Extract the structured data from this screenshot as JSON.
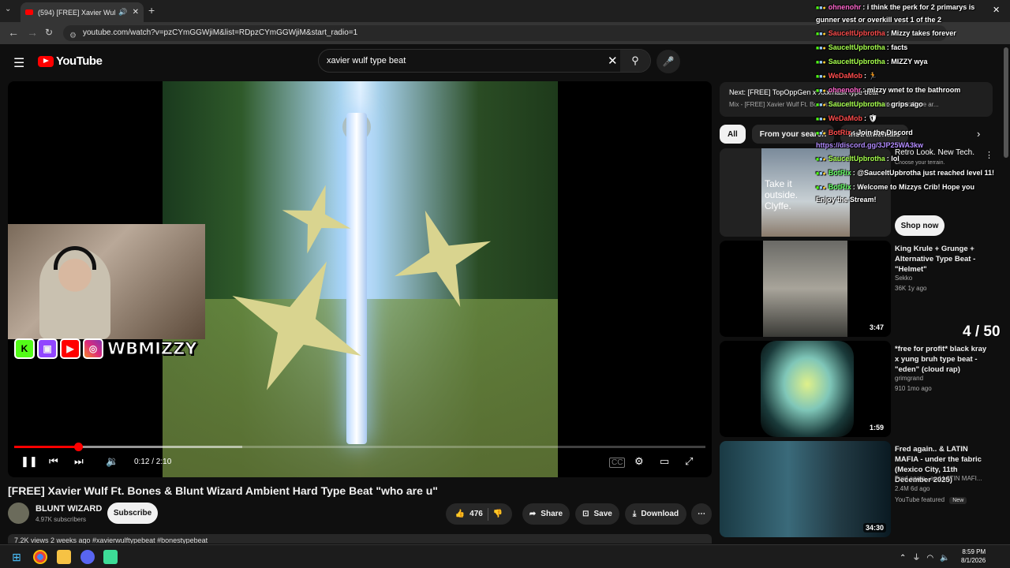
{
  "browser": {
    "tab_title": "(594) [FREE] Xavier Wulf Ft. Bo",
    "url": "youtube.com/watch?v=pzCYmGGWjiM&list=RDpzCYmGGWjiM&start_radio=1"
  },
  "header": {
    "logo_text": "YouTube",
    "search_query": "xavier wulf type beat"
  },
  "player": {
    "current_time": "0:12",
    "duration": "2:10",
    "time_display": "0:12 / 2:10",
    "played_fraction": 0.092,
    "buffered_fraction": 0.33,
    "social_handle": "WBMIZZY"
  },
  "video": {
    "title": "[FREE] Xavier Wulf Ft. Bones & Blunt Wizard Ambient Hard Type Beat \"who are u\"",
    "channel": "BLUNT WIZARD",
    "subscribers": "4.97K subscribers",
    "subscribe_label": "Subscribe",
    "likes": "476",
    "share_label": "Share",
    "save_label": "Save",
    "download_label": "Download",
    "description_peek": "7.2K views  2 weeks ago  #xavierwulftypebeat #bonestypebeat"
  },
  "sidebar": {
    "up_next_line1": "Next: [FREE] TopOppGen x Xxxmask type beat",
    "up_next_line2": "Mix - [FREE] Xavier Wulf Ft. Bones & Blunt Wizard Ambient Hard Type ar...",
    "chips": [
      "All",
      "From your search",
      "Instrumentals"
    ],
    "ad": {
      "image_text": "Take it outside. Clyffe.",
      "title": "Retro Look. New Tech.",
      "subtitle": "Choose your terrain.",
      "cta": "Shop now"
    },
    "recommendations": [
      {
        "title": "King Krule + Grunge + Alternative Type Beat - \"Helmet\"",
        "channel": "Sekko",
        "meta": "36K  1y ago",
        "duration": ""
      },
      {
        "title": "*free for profit* black kray x yung bruh type beat - \"eden\" (cloud rap)",
        "channel": "grimgrand",
        "meta": "910  1mo ago",
        "duration": "1:59"
      },
      {
        "title": "Fred again.. & LATIN MAFIA - under the fabric (Mexico City, 11th December 2025)",
        "channel": "Fred again.. and LATIN MAFI...",
        "meta": "2.4M  6d ago",
        "duration": "34:30",
        "featured": "YouTube featured",
        "badge": "New"
      }
    ],
    "rec1_duration": "3:47"
  },
  "overlay": {
    "counter": "4 / 50",
    "chat": [
      {
        "user": "ohnenohr",
        "color": "#ff66cc",
        "msg": "i think the perk for 2 primarys is gunner vest or overkill vest 1 of the 2"
      },
      {
        "user": "SauceItUpbrotha",
        "color": "#ff4d4d",
        "msg": "Mizzy takes forever"
      },
      {
        "user": "SauceItUpbrotha",
        "color": "#a6ff4d",
        "msg": "facts"
      },
      {
        "user": "SauceItUpbrotha",
        "color": "#a6ff4d",
        "msg": "MIZZY wya"
      },
      {
        "user": "WeDaMob",
        "color": "#ff4d4d",
        "msg": "🏃"
      },
      {
        "user": "ohnenohr",
        "color": "#ff66cc",
        "msg": "mizzy wnet to the bathroom"
      },
      {
        "user": "SauceItUpbrotha",
        "color": "#a6ff4d",
        "msg": "grips ago"
      },
      {
        "user": "WeDaMob",
        "color": "#ff4d4d",
        "msg": "🛡"
      },
      {
        "user": "BotRix",
        "color": "#ff4d4d",
        "msg": "Join the Discord https://discord.gg/3JP25WA3kw"
      },
      {
        "user": "SauceItUpbrotha",
        "color": "#a6ff4d",
        "msg": "lol"
      },
      {
        "user": "BotRix",
        "color": "#66ff66",
        "msg": "@SauceItUpbrotha just reached level 11!"
      },
      {
        "user": "BotRix",
        "color": "#66ff66",
        "msg": "Welcome to Mizzys Crib! Hope you Enjoy the Stream!"
      }
    ]
  },
  "taskbar": {
    "time": "8:59 PM",
    "date": "8/1/2026"
  }
}
